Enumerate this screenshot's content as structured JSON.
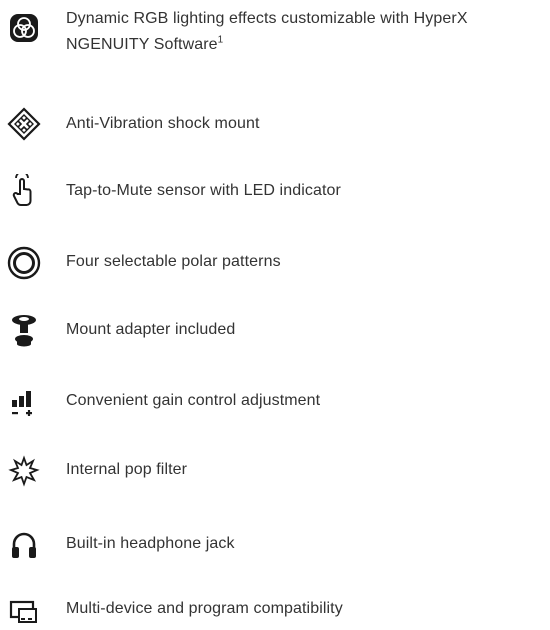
{
  "features": [
    {
      "icon": "rgb-lighting-icon",
      "text": "Dynamic RGB lighting effects customizable with HyperX NGENUITY Software",
      "footnote": "1"
    },
    {
      "icon": "anti-vibration-icon",
      "text": "Anti-Vibration shock mount"
    },
    {
      "icon": "tap-to-mute-icon",
      "text": "Tap-to-Mute sensor with LED indicator"
    },
    {
      "icon": "polar-pattern-icon",
      "text": "Four selectable polar patterns"
    },
    {
      "icon": "mount-adapter-icon",
      "text": "Mount adapter included"
    },
    {
      "icon": "gain-control-icon",
      "text": "Convenient gain control adjustment"
    },
    {
      "icon": "pop-filter-icon",
      "text": "Internal pop filter"
    },
    {
      "icon": "headphone-jack-icon",
      "text": "Built-in headphone jack"
    },
    {
      "icon": "multi-device-icon",
      "text": "Multi-device and program compatibility"
    }
  ]
}
